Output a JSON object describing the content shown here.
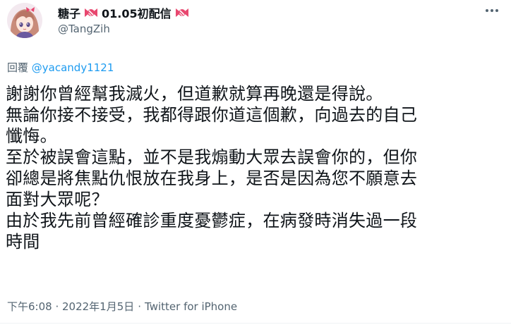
{
  "author": {
    "display_name": "糖子",
    "name_suffix": "01.05初配信",
    "handle": "@TangZih"
  },
  "icons": {
    "candy_left": "candy-icon",
    "candy_right": "candy-icon",
    "more": "more-horizontal-icon"
  },
  "reply": {
    "prefix": "回覆",
    "mention": "@yacandy1121"
  },
  "tweet": {
    "lines": [
      "謝謝你曾經幫我滅火，但道歉就算再晚還是得說。",
      "無論你接不接受，我都得跟你道這個歉，向過去的自己",
      "懺悔。",
      "至於被誤會這點，並不是我煽動大眾去誤會你的，但你",
      "卻總是將焦點仇恨放在我身上，是否是因為您不願意去",
      "面對大眾呢？",
      "由於我先前曾經確診重度憂鬱症，在病發時消失過一段",
      "時間"
    ]
  },
  "meta": {
    "timestamp": "下午6:08 · 2022年1月5日",
    "separator": "·",
    "source": "Twitter for iPhone"
  },
  "colors": {
    "text": "#0f1419",
    "secondary": "#536471",
    "link": "#1d9bf0",
    "divider": "#eff3f4",
    "candy_pink": "#e8476f"
  }
}
